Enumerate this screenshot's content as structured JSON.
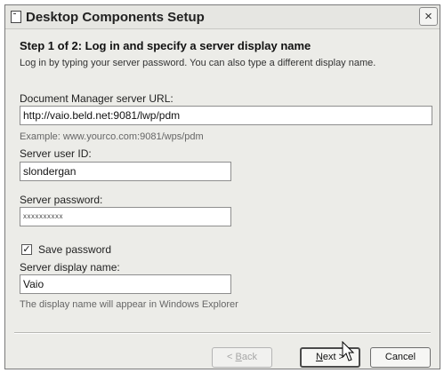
{
  "window": {
    "title": "Desktop Components Setup",
    "close_label": "×"
  },
  "step": {
    "heading": "Step 1 of 2: Log in and specify a server display name",
    "instruction": "Log in by typing your server password. You can also type a different display name."
  },
  "fields": {
    "server_url": {
      "label": "Document Manager server URL:",
      "value": "http://vaio.beld.net:9081/lwp/pdm",
      "example": "Example: www.yourco.com:9081/wps/pdm"
    },
    "user_id": {
      "label": "Server user ID:",
      "value": "slondergan"
    },
    "password": {
      "label": "Server password:",
      "value": "xxxxxxxxxx"
    },
    "save_password": {
      "label": "Save password",
      "checked": true,
      "mark": "✓"
    },
    "display_name": {
      "label": "Server display name:",
      "value": "Vaio",
      "hint": "The display name will appear in Windows Explorer"
    }
  },
  "buttons": {
    "back": {
      "prefix": "< ",
      "mnemonic": "B",
      "rest": "ack",
      "enabled": false
    },
    "next": {
      "mnemonic": "N",
      "rest": "ext >",
      "enabled": true
    },
    "cancel": {
      "label": "Cancel"
    }
  }
}
